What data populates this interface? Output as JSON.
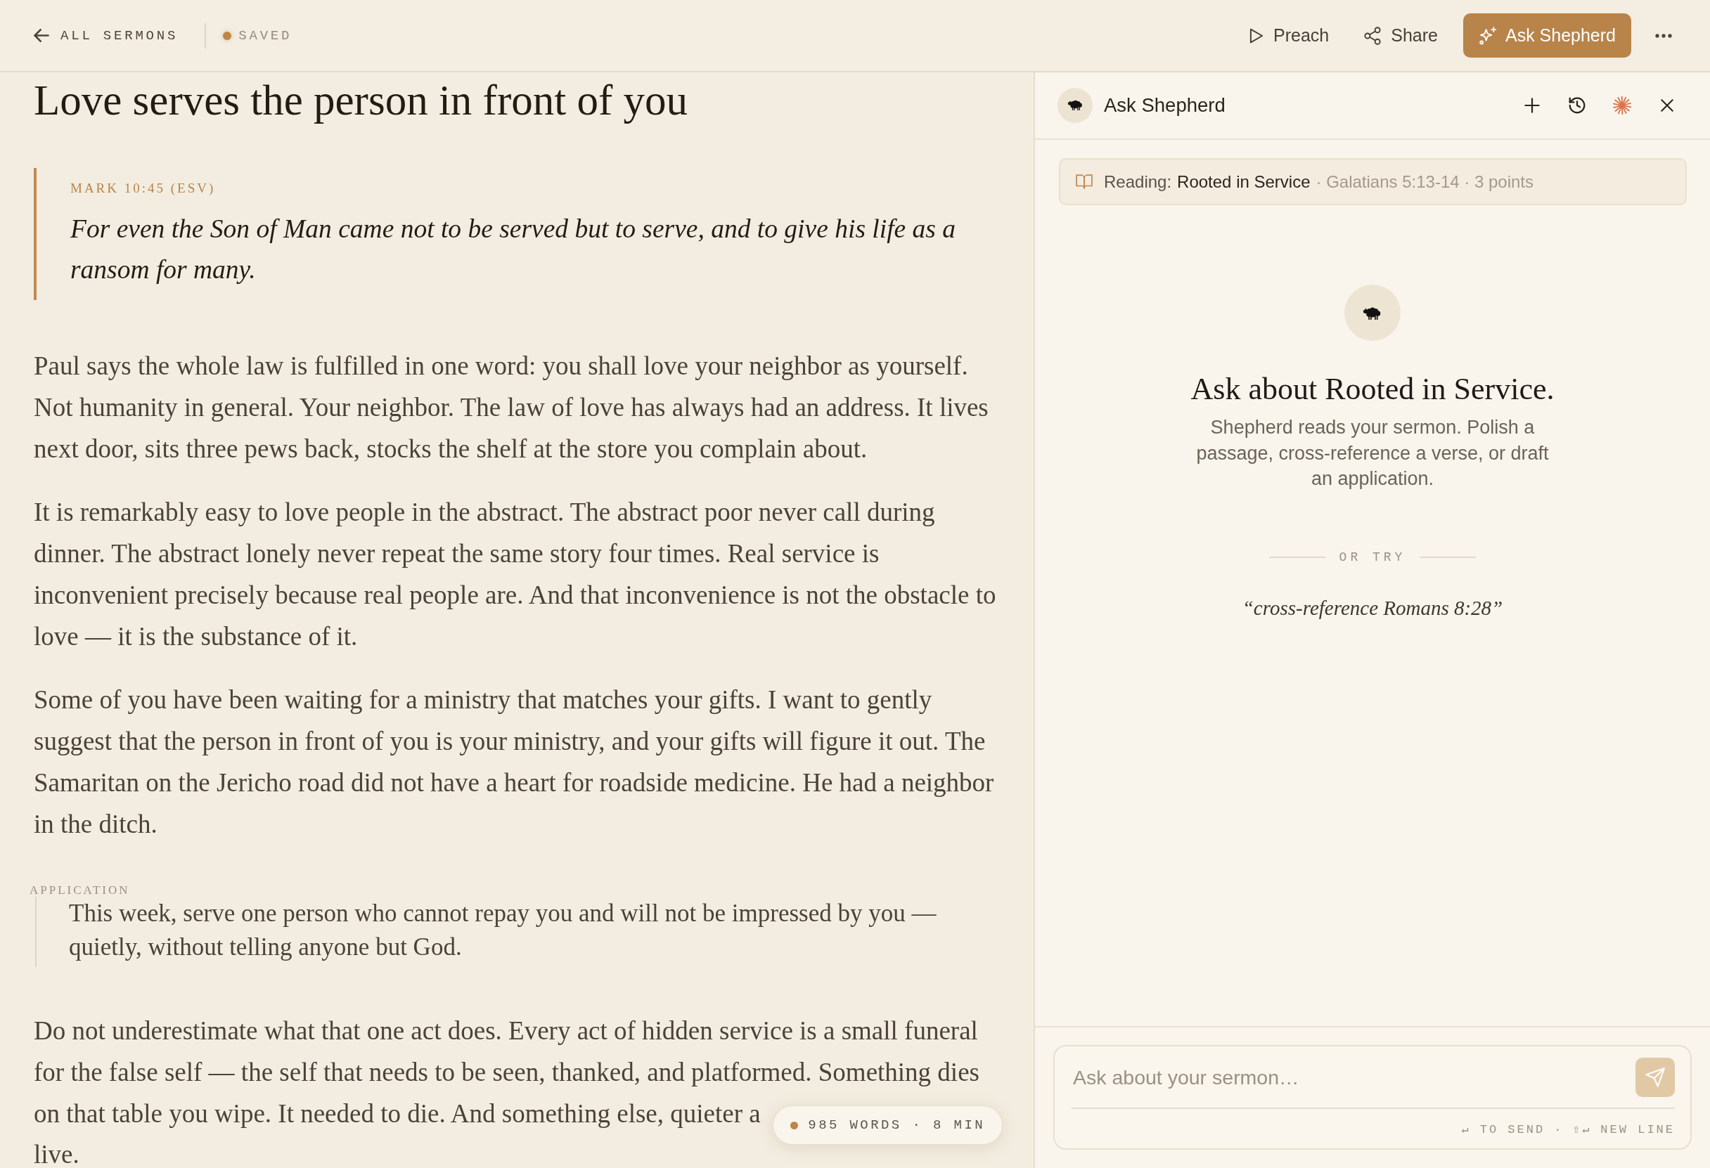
{
  "toolbar": {
    "back": {
      "label": "ALL SERMONS"
    },
    "save_status": "SAVED",
    "actions": [
      {
        "kind": "preach",
        "label": "Preach",
        "primary": false
      },
      {
        "kind": "share",
        "label": "Share",
        "primary": false
      },
      {
        "kind": "ask",
        "label": "Ask Shepherd",
        "primary": true
      }
    ]
  },
  "editor": {
    "title": "Love serves the person in front of you",
    "scripture": {
      "reference": "MARK 10:45 (ESV)",
      "text": "For even the Son of Man came not to be served but to serve, and to give his life as a ransom for many."
    },
    "blocks": [
      {
        "kind": "paragraph",
        "text": "Paul says the whole law is fulfilled in one word: you shall love your neighbor as yourself. Not humanity in general. Your neighbor. The law of love has always had an address. It lives next door, sits three pews back, stocks the shelf at the store you complain about."
      },
      {
        "kind": "paragraph",
        "text": "It is remarkably easy to love people in the abstract. The abstract poor never call during dinner. The abstract lonely never repeat the same story four times. Real service is inconvenient precisely because real people are. And that inconvenience is not the obstacle to love — it is the substance of it."
      },
      {
        "kind": "paragraph",
        "text": "Some of you have been waiting for a ministry that matches your gifts. I want to gently suggest that the person in front of you is your ministry, and your gifts will figure it out. The Samaritan on the Jericho road did not have a heart for roadside medicine. He had a neighbor in the ditch."
      },
      {
        "kind": "application",
        "label": "APPLICATION",
        "text": "This week, serve one person who cannot repay you and will not be impressed by you — quietly, without telling anyone but God."
      },
      {
        "kind": "paragraph",
        "text": "Do not underestimate what that one act does. Every act of hidden service is a small funeral for the false self — the self that needs to be seen, thanked, and platformed. Something dies",
        "lines": [
          "on that table you wipe. It needed to die. And something else, quieter a",
          "live."
        ]
      }
    ],
    "word_count": "985 WORDS · 8 MIN"
  },
  "assistant": {
    "title": "Ask Shepherd",
    "context": {
      "label": "Reading:",
      "sermon": "Rooted in Service",
      "meta": "· Galatians 5:13-14 · 3 points"
    },
    "empty_state": {
      "heading": "Ask about Rooted in Service.",
      "description": "Shepherd reads your sermon. Polish a passage, cross-reference a verse, or draft an application.",
      "divider": "OR TRY",
      "suggestions": [
        "“cross-reference Romans 8:28”"
      ]
    },
    "composer": {
      "placeholder": "Ask about your sermon…",
      "hint": "↵ TO SEND · ⇧↵ NEW LINE"
    }
  }
}
